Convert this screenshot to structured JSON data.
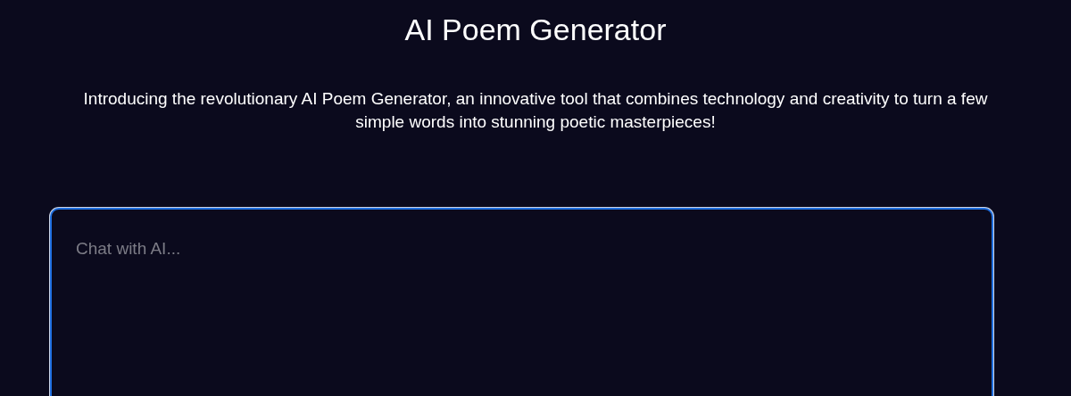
{
  "title": "AI Poem Generator",
  "description": "Introducing the revolutionary AI Poem Generator, an innovative tool that combines technology and creativity to turn a few simple words into stunning poetic masterpieces!",
  "chat_input": {
    "placeholder": "Chat with AI..."
  }
}
